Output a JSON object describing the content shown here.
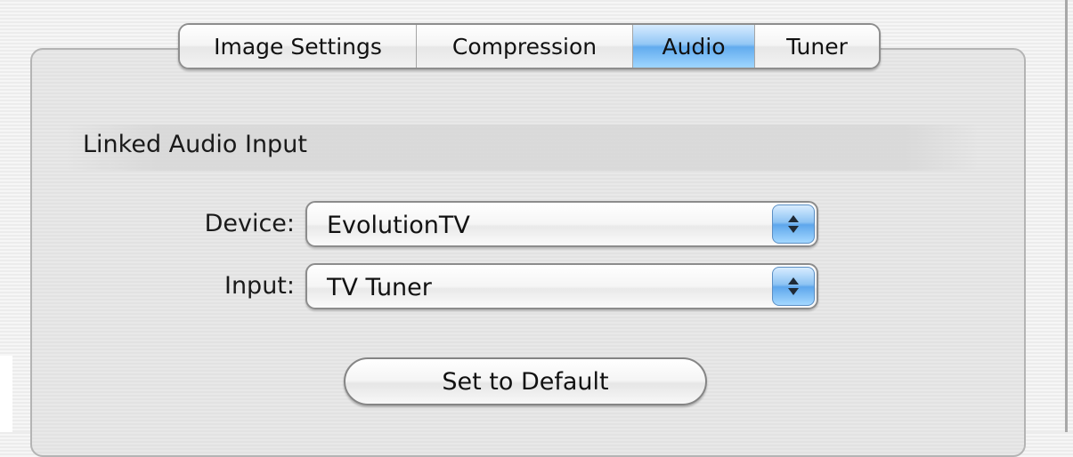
{
  "tabs": [
    {
      "label": "Image Settings",
      "selected": false
    },
    {
      "label": "Compression",
      "selected": false
    },
    {
      "label": "Audio",
      "selected": true
    },
    {
      "label": "Tuner",
      "selected": false
    }
  ],
  "section": {
    "title": "Linked Audio Input"
  },
  "fields": {
    "device": {
      "label": "Device:",
      "value": "EvolutionTV"
    },
    "input": {
      "label": "Input:",
      "value": "TV Tuner"
    }
  },
  "buttons": {
    "set_default": "Set to Default"
  },
  "colors": {
    "selected_tab": "#62abee",
    "popup_arrows": "#5ea7ec"
  },
  "icons": {
    "popup_arrows": "up-down-chevron-icon"
  }
}
